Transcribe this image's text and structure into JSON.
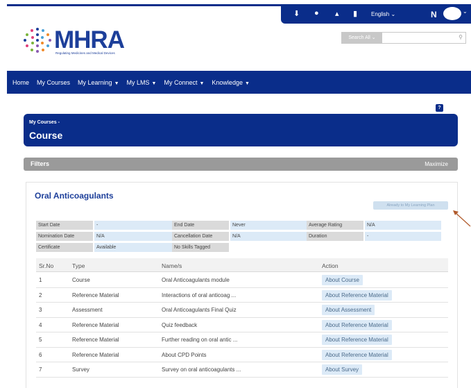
{
  "utility_bar": {
    "language": "English",
    "user_initial": "N"
  },
  "logo": {
    "name": "MHRA",
    "tagline": "Regulating Medicines and Medical Devices"
  },
  "search": {
    "scope": "Search All"
  },
  "nav": {
    "items": [
      "Home",
      "My Courses",
      "My Learning",
      "My LMS",
      "My Connect",
      "Knowledge"
    ]
  },
  "page_header": {
    "breadcrumb": "My Courses -",
    "title": "Course"
  },
  "filters": {
    "label": "Filters",
    "maximize": "Maximize"
  },
  "course": {
    "title": "Oral Anticoagulants",
    "plan_button": "Already to My Learning Plan",
    "info": {
      "start_date_label": "Start Date",
      "start_date": "-",
      "end_date_label": "End Date",
      "end_date": "Never",
      "avg_rating_label": "Average Rating",
      "avg_rating": "N/A",
      "nomination_label": "Nomination Date",
      "nomination": "N/A",
      "cancellation_label": "Cancellation Date",
      "cancellation": "N/A",
      "duration_label": "Duration",
      "duration": "-",
      "certificate_label": "Certificate",
      "certificate": "Available",
      "skills": "No Skills Tagged"
    },
    "table": {
      "headers": [
        "Sr.No",
        "Type",
        "Name/s",
        "Action"
      ],
      "rows": [
        {
          "no": "1",
          "type": "Course",
          "name": "Oral Anticoagulants module",
          "action": "About Course"
        },
        {
          "no": "2",
          "type": "Reference Material",
          "name": "Interactions of oral anticoag ...",
          "action": "About Reference Material"
        },
        {
          "no": "3",
          "type": "Assessment",
          "name": "Oral Anticoagulants Final Quiz",
          "action": "About Assessment"
        },
        {
          "no": "4",
          "type": "Reference Material",
          "name": "Quiz feedback",
          "action": "About Reference Material"
        },
        {
          "no": "5",
          "type": "Reference Material",
          "name": "Further reading on oral antic ...",
          "action": "About Reference Material"
        },
        {
          "no": "6",
          "type": "Reference Material",
          "name": "About CPD Points",
          "action": "About Reference Material"
        },
        {
          "no": "7",
          "type": "Survey",
          "name": "Survey on oral anticoagulants ...",
          "action": "About Survey"
        }
      ]
    }
  },
  "colors": {
    "brand_blue": "#0a2d8a",
    "filter_gray": "#9a9a9a",
    "action_bg": "#dceaf7",
    "arrow": "#b0592a"
  }
}
